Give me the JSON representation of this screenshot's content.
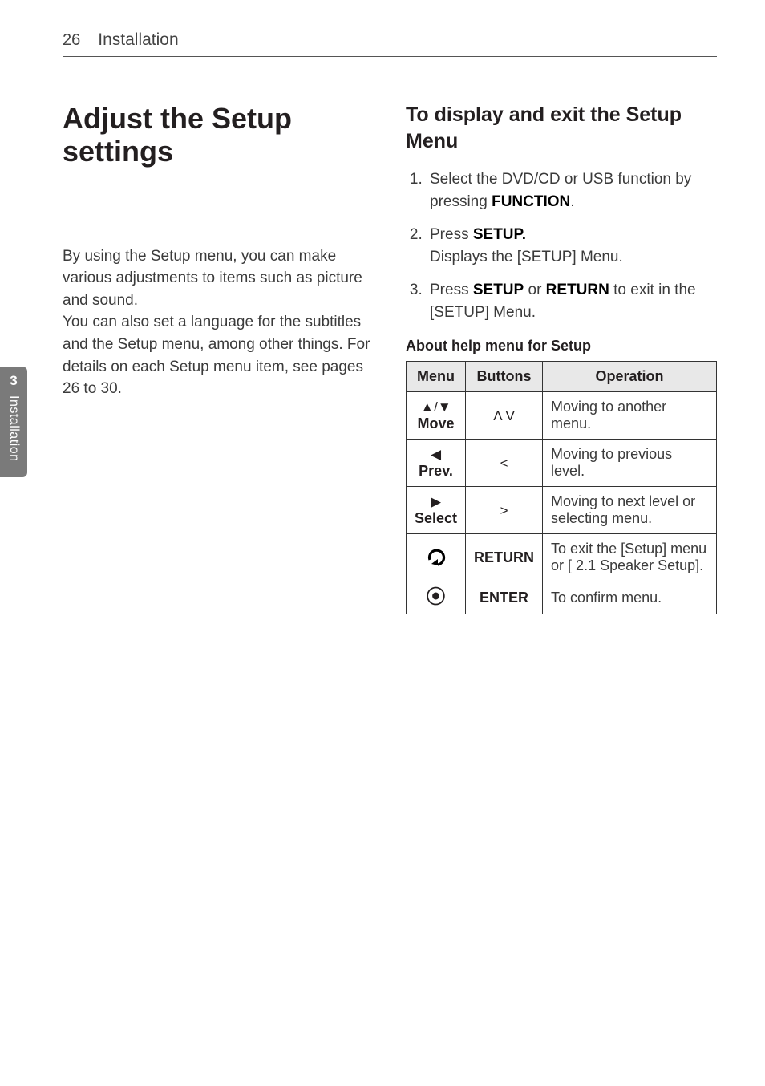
{
  "header": {
    "page_number": "26",
    "title": "Installation"
  },
  "side_tab": {
    "number": "3",
    "label": "Installation"
  },
  "left": {
    "heading": "Adjust the Setup settings",
    "para1": "By using the Setup menu, you can make various adjustments to items such as picture and sound.",
    "para2": "You can also set a language for the subtitles and the Setup menu, among other things. For details on each Setup menu item, see pages 26 to 30."
  },
  "right": {
    "heading": "To display and exit the Setup Menu",
    "steps": [
      {
        "pre": "Select the DVD/CD or USB function by pressing ",
        "bold": "FUNCTION",
        "post": "."
      },
      {
        "pre": "Press ",
        "bold": "SETUP.",
        "post": "",
        "line2": "Displays the [SETUP] Menu."
      },
      {
        "pre": "Press ",
        "bold": "SETUP",
        "mid": " or ",
        "bold2": "RETURN",
        "post": " to exit in the [SETUP] Menu."
      }
    ],
    "table_caption": "About help menu for Setup",
    "th": {
      "menu": "Menu",
      "buttons": "Buttons",
      "operation": "Operation"
    },
    "rows": [
      {
        "menu_sym": "▲/▼",
        "menu_label": "Move",
        "button": "Λ  V",
        "op": "Moving to another menu."
      },
      {
        "menu_sym": "◀",
        "menu_label": "Prev.",
        "button": "<",
        "op": "Moving to previous level."
      },
      {
        "menu_sym": "▶",
        "menu_label": "Select",
        "button": ">",
        "op": "Moving to next level or selecting menu."
      },
      {
        "menu_icon": "return",
        "button": "RETURN",
        "op": "To exit the [Setup] menu or [ 2.1 Speaker Setup]."
      },
      {
        "menu_icon": "enter",
        "button": "ENTER",
        "op": "To confirm menu."
      }
    ]
  }
}
